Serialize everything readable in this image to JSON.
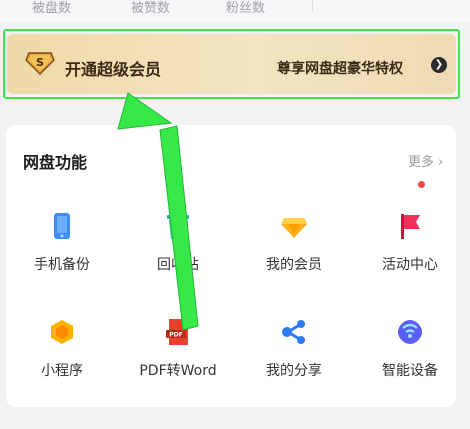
{
  "stats": {
    "items": [
      {
        "label": "被盘数"
      },
      {
        "label": "被赞数"
      },
      {
        "label": "粉丝数"
      }
    ]
  },
  "vip_banner": {
    "badge_letter": "S",
    "title": "开通超级会员",
    "subtitle": "尊享网盘超豪华特权",
    "arrow": "❯"
  },
  "features_card": {
    "title": "网盘功能",
    "more_label": "更多",
    "more_chevron": "›",
    "items": [
      {
        "label": "手机备份",
        "icon": "phone-backup-icon"
      },
      {
        "label": "回收站",
        "icon": "recycle-bin-icon"
      },
      {
        "label": "我的会员",
        "icon": "diamond-icon"
      },
      {
        "label": "活动中心",
        "icon": "flag-icon"
      },
      {
        "label": "小程序",
        "icon": "mini-program-icon"
      },
      {
        "label": "PDF转Word",
        "icon": "pdf-icon"
      },
      {
        "label": "我的分享",
        "icon": "share-icon"
      },
      {
        "label": "智能设备",
        "icon": "smart-device-icon"
      }
    ]
  },
  "colors": {
    "highlight_outline": "#3ee64a",
    "vip_gold": "#efd9a8",
    "vip_text": "#3a2a16"
  }
}
